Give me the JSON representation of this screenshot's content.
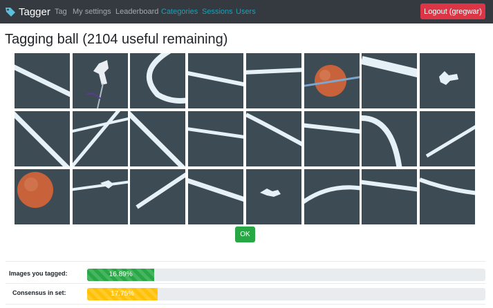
{
  "navbar": {
    "brand": "Tagger",
    "links": {
      "tag": "Tag",
      "my_settings": "My settings",
      "leaderboard": "Leaderboard",
      "categories": "Categories",
      "sessions": "Sessions",
      "users": "Users"
    },
    "logout_label": "Logout (gregwar)"
  },
  "page_title": "Tagging ball (2104 useful remaining)",
  "tiles": [
    "line",
    "robot-part",
    "arc",
    "line",
    "line",
    "ball",
    "line",
    "blob",
    "line",
    "line",
    "line",
    "line",
    "curve",
    "line",
    "arc",
    "line",
    "ball",
    "blob",
    "line",
    "line",
    "blob",
    "arc",
    "line",
    "arc"
  ],
  "ok_label": "OK",
  "stats": {
    "tagged": {
      "label": "Images you tagged:",
      "value": 16.89,
      "text": "16.89%"
    },
    "consensus": {
      "label": "Consensus in set:",
      "value": 17.75,
      "text": "17.75%"
    }
  },
  "colors": {
    "navbar": "#343a40",
    "logout": "#dc3545",
    "ok": "#28a745",
    "progress_green": "#28a745",
    "progress_yellow": "#ffc107",
    "nav_accent": "#17a2b8",
    "field": "#3d4b55",
    "line": "#e6f0f7",
    "ball": "#c8623a"
  }
}
